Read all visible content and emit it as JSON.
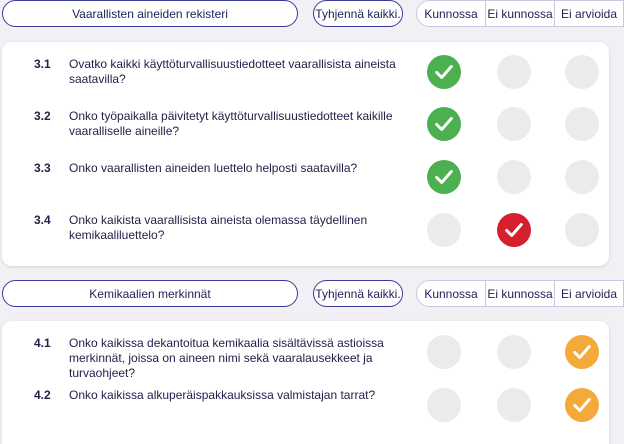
{
  "status_headers": [
    "Kunnossa",
    "Ei kunnossa",
    "Ei arvioida"
  ],
  "clear_label": "Tyhjennä kaikki.",
  "colors": {
    "ok": "#4caf50",
    "not_ok": "#d61f2c",
    "na": "#f4a93b",
    "empty": "#ebebed",
    "accent": "#3a3a9a"
  },
  "sections": [
    {
      "title": "Vaarallisten aineiden rekisteri",
      "questions": [
        {
          "num": "3.1",
          "text": "Ovatko kaikki käyttöturvallisuustiedotteet vaarallisista aineista saatavilla?",
          "answer": "ok"
        },
        {
          "num": "3.2",
          "text": "Onko työpaikalla päivitetyt käyttöturvallisuustiedotteet kaikille vaaralliselle aineille?",
          "answer": "ok"
        },
        {
          "num": "3.3",
          "text": "Onko vaarallisten aineiden luettelo helposti saatavilla?",
          "answer": "ok"
        },
        {
          "num": "3.4",
          "text": "Onko kaikista vaarallisista aineista olemassa täydellinen kemikaaliluettelo?",
          "answer": "not_ok"
        }
      ]
    },
    {
      "title": "Kemikaalien merkinnät",
      "questions": [
        {
          "num": "4.1",
          "text": "Onko kaikissa dekantoitua kemikaalia sisältävissä astioissa merkinnät, joissa on aineen nimi sekä vaaralausekkeet ja turvaohjeet?",
          "answer": "na"
        },
        {
          "num": "4.2",
          "text": "Onko kaikissa alkuperäispakkauksissa valmistajan tarrat?",
          "answer": "na"
        }
      ]
    }
  ]
}
